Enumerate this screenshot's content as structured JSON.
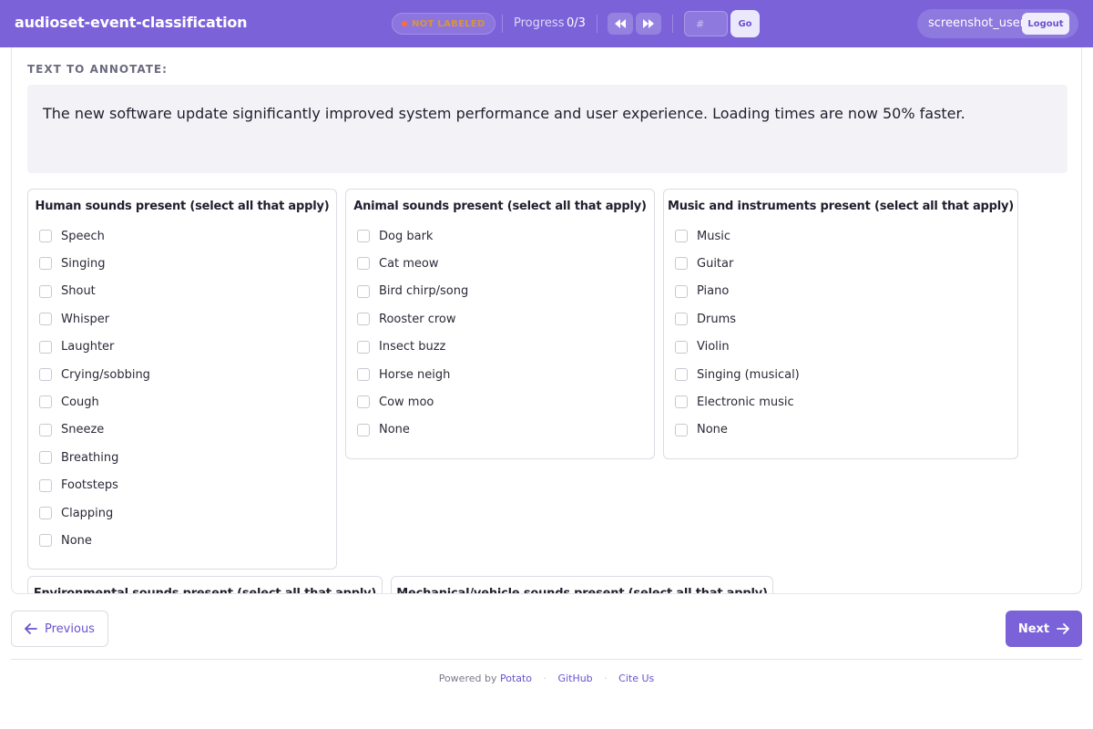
{
  "header": {
    "app_title": "audioset-event-classification",
    "status": "NOT LABELED",
    "progress_label": "Progress",
    "progress_value": "0/3",
    "goto_placeholder": "#",
    "go_label": "Go",
    "username": "screenshot_user",
    "logout_label": "Logout"
  },
  "main": {
    "section_label": "TEXT TO ANNOTATE:",
    "text": "The new software update significantly improved system performance and user experience. Loading times are now 50% faster."
  },
  "groups": [
    {
      "title": "Human sounds present (select all that apply)",
      "options": [
        "Speech",
        "Singing",
        "Shout",
        "Whisper",
        "Laughter",
        "Crying/sobbing",
        "Cough",
        "Sneeze",
        "Breathing",
        "Footsteps",
        "Clapping",
        "None"
      ]
    },
    {
      "title": "Animal sounds present (select all that apply)",
      "options": [
        "Dog bark",
        "Cat meow",
        "Bird chirp/song",
        "Rooster crow",
        "Insect buzz",
        "Horse neigh",
        "Cow moo",
        "None"
      ]
    },
    {
      "title": "Music and instruments present (select all that apply)",
      "options": [
        "Music",
        "Guitar",
        "Piano",
        "Drums",
        "Violin",
        "Singing (musical)",
        "Electronic music",
        "None"
      ]
    },
    {
      "title": "Environmental sounds present (select all that apply)",
      "options": []
    },
    {
      "title": "Mechanical/vehicle sounds present (select all that apply)",
      "options": []
    }
  ],
  "nav": {
    "previous_label": "Previous",
    "next_label": "Next"
  },
  "footer": {
    "powered_by": "Powered by",
    "potato": "Potato",
    "github": "GitHub",
    "cite": "Cite Us"
  },
  "colors": {
    "accent": "#7b62d9",
    "status_dot": "#ff6b35"
  }
}
